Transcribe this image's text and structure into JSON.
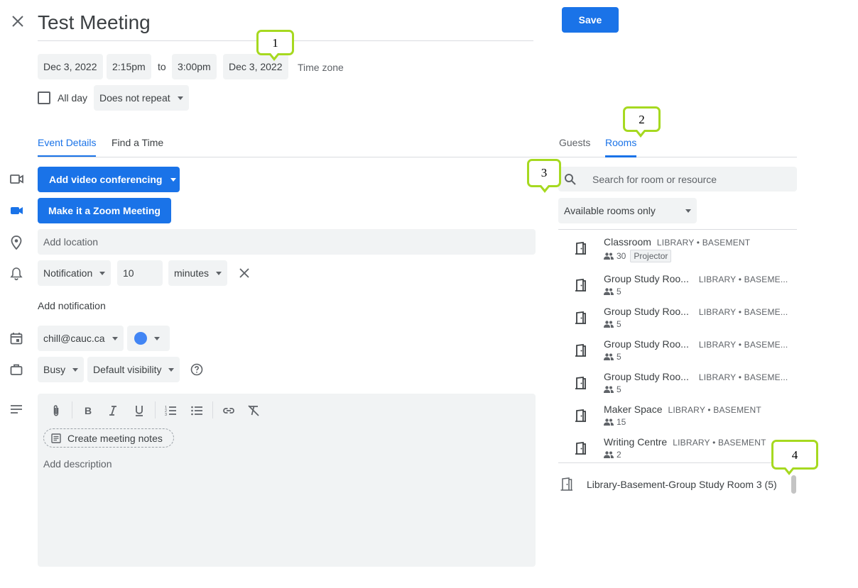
{
  "event": {
    "title": "Test Meeting",
    "save_label": "Save",
    "start_date": "Dec 3, 2022",
    "start_time": "2:15pm",
    "to_label": "to",
    "end_time": "3:00pm",
    "end_date": "Dec 3, 2022",
    "timezone_label": "Time zone",
    "all_day_label": "All day",
    "repeat_value": "Does not repeat"
  },
  "tabs": {
    "event_details": "Event Details",
    "find_time": "Find a Time"
  },
  "details": {
    "video_conf_label": "Add video conferencing",
    "zoom_label": "Make it a Zoom Meeting",
    "location_placeholder": "Add location",
    "notification_type": "Notification",
    "notification_value": "10",
    "notification_unit": "minutes",
    "add_notification": "Add notification",
    "calendar": "chill@cauc.ca",
    "calendar_color": "#4285f4",
    "busy": "Busy",
    "visibility": "Default visibility",
    "meeting_notes": "Create meeting notes",
    "description_placeholder": "Add description"
  },
  "right_panel": {
    "guests_tab": "Guests",
    "rooms_tab": "Rooms",
    "search_placeholder": "Search for room or resource",
    "filter": "Available rooms only",
    "rooms": [
      {
        "name": "Classroom",
        "location": "LIBRARY • BASEMENT",
        "capacity": "30",
        "feature": "Projector"
      },
      {
        "name": "Group Study Roo...",
        "location": "LIBRARY • BASEME...",
        "capacity": "5"
      },
      {
        "name": "Group Study Roo...",
        "location": "LIBRARY • BASEME...",
        "capacity": "5"
      },
      {
        "name": "Group Study Roo...",
        "location": "LIBRARY • BASEME...",
        "capacity": "5"
      },
      {
        "name": "Group Study Roo...",
        "location": "LIBRARY • BASEME...",
        "capacity": "5"
      },
      {
        "name": "Maker Space",
        "location": "LIBRARY • BASEMENT",
        "capacity": "15"
      },
      {
        "name": "Writing Centre",
        "location": "LIBRARY • BASEMENT",
        "capacity": "2"
      }
    ],
    "selected_room": "Library-Basement-Group Study Room 3 (5)"
  },
  "callouts": [
    "1",
    "2",
    "3",
    "4"
  ],
  "colors": {
    "accent": "#1a73e8",
    "callout_border": "#a6d920"
  }
}
